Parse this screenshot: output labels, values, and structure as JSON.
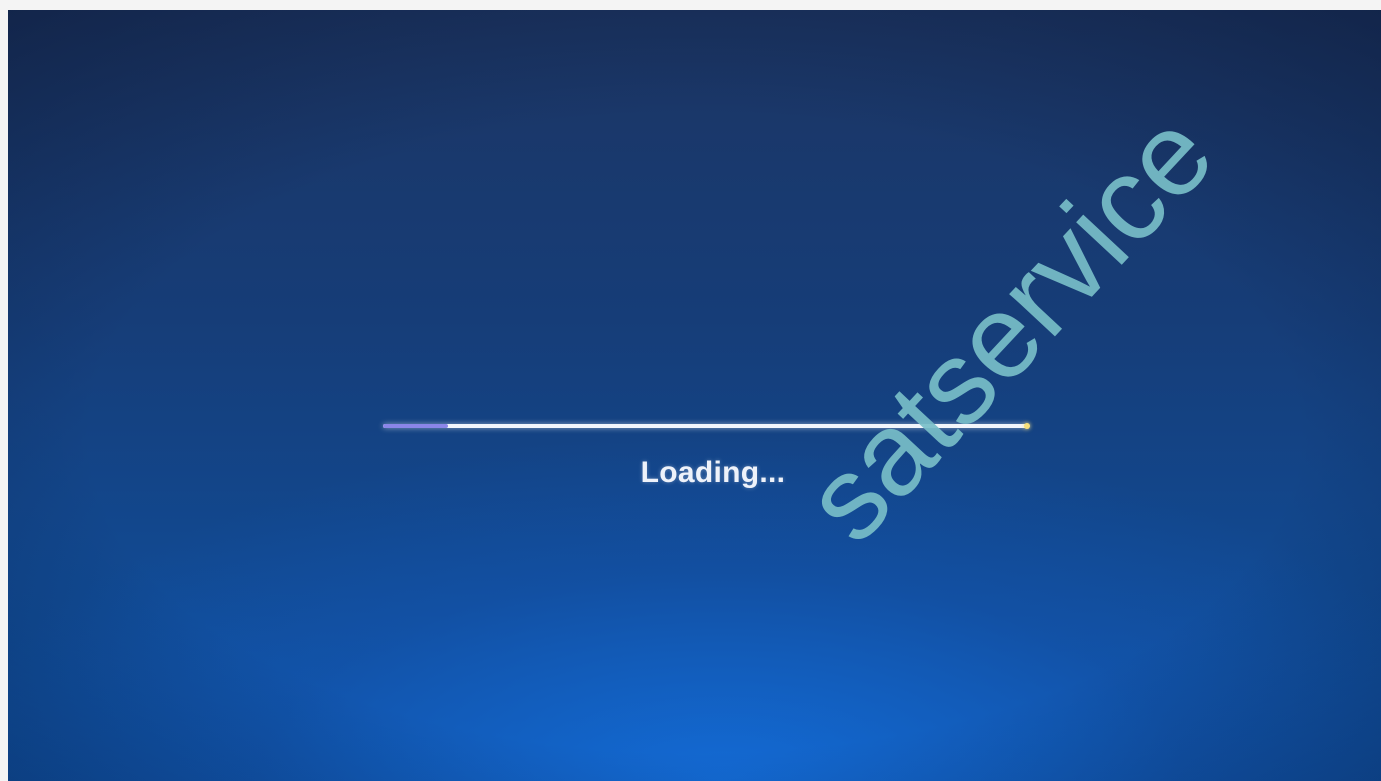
{
  "loading": {
    "label": "Loading...",
    "progress_percent": 10
  },
  "watermark": {
    "text": "satservice"
  },
  "colors": {
    "progress_fill": "#8b86e8",
    "progress_track": "#f2f5fb",
    "background_top": "#1c3563",
    "background_bottom": "#0f55aa",
    "watermark": "#78bec8"
  }
}
